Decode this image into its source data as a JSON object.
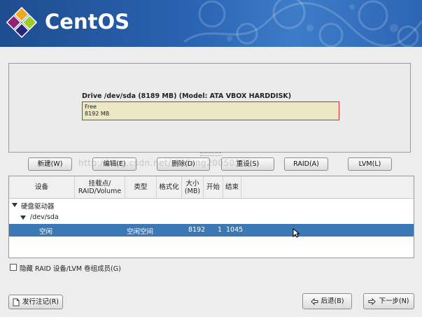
{
  "header": {
    "brand": "CentOS"
  },
  "drive": {
    "title": "Drive /dev/sda (8189 MB) (Model: ATA VBOX HARDDISK)",
    "free_label": "Free",
    "free_size": "8192 MB"
  },
  "buttons": {
    "new": "新建(W)",
    "edit": "编辑(E)",
    "delete": "删除(D)",
    "reset": "重设(S)",
    "raid": "RAID(A)",
    "lvm": "LVM(L)"
  },
  "watermark": "http://blog.csdn.net/zkefeng20050520",
  "table": {
    "headers": {
      "device": "设备",
      "mount": "挂载点/ RAID/Volume",
      "type": "类型",
      "format": "格式化",
      "size": "大小 (MB)",
      "start": "开始",
      "end": "结束"
    },
    "group": "硬盘驱动器",
    "disk": "/dev/sda",
    "free_row": {
      "device": "空闲",
      "type": "空闲空间",
      "size": "8192",
      "start": "1",
      "end": "1045"
    }
  },
  "hide_checkbox": {
    "label": "隐藏 RAID 设备/LVM 卷组成员(G)",
    "checked": false
  },
  "footer": {
    "release_notes": "发行注记(R)",
    "back": "后退(B)",
    "next": "下一步(N)"
  },
  "colors": {
    "header_blue": "#2a63b1",
    "selected_row": "#3c78b4",
    "free_fill": "#ece7c4",
    "free_border": "#d9262d"
  }
}
